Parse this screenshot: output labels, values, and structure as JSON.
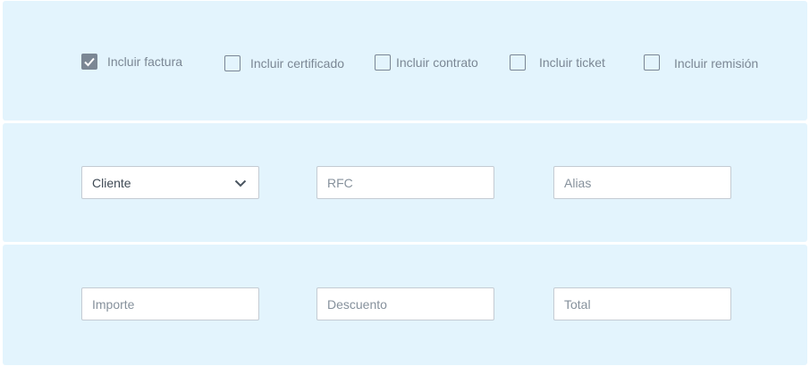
{
  "options": [
    {
      "label": "Incluir factura",
      "checked": true
    },
    {
      "label": "Incluir certificado",
      "checked": false
    },
    {
      "label": "Incluir contrato",
      "checked": false
    },
    {
      "label": "Incluir ticket",
      "checked": false
    },
    {
      "label": "Incluir remisión",
      "checked": false
    }
  ],
  "client_row": {
    "client_select": {
      "value": "Cliente",
      "icon": "chevron-down-icon"
    },
    "rfc": {
      "placeholder": "RFC",
      "value": ""
    },
    "alias": {
      "placeholder": "Alias",
      "value": ""
    }
  },
  "amount_row": {
    "importe": {
      "placeholder": "Importe",
      "value": ""
    },
    "descuento": {
      "placeholder": "Descuento",
      "value": ""
    },
    "total": {
      "placeholder": "Total",
      "value": ""
    }
  },
  "colors": {
    "panel_background": "#e3f4fd",
    "checkbox_checked": "#7b8794",
    "input_border": "#c4cbd3"
  }
}
